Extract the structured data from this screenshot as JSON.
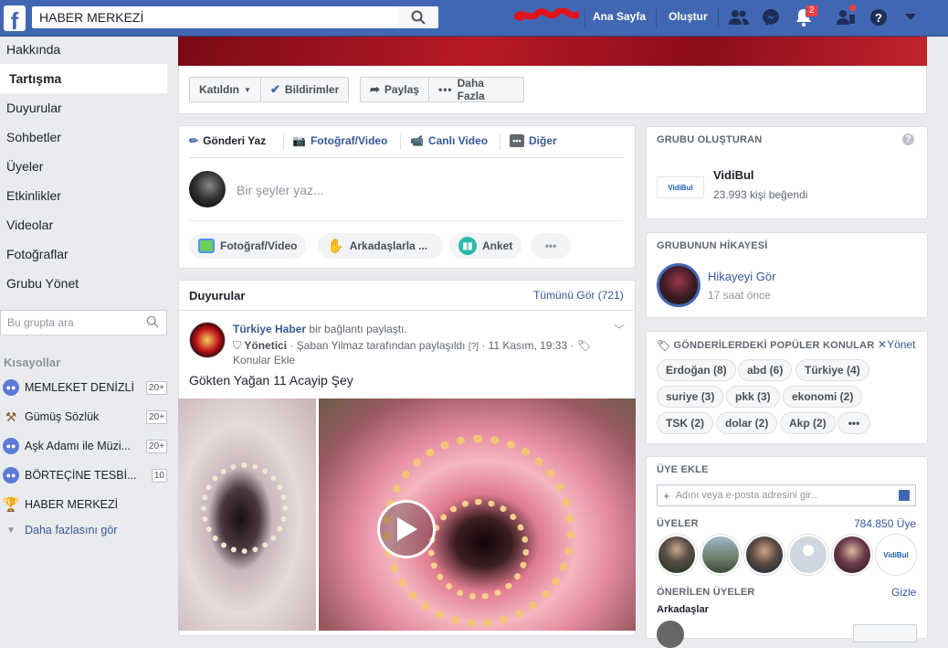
{
  "topbar": {
    "search_value": "HABER MERKEZİ",
    "home": "Ana Sayfa",
    "create": "Oluştur",
    "notif_count": "2"
  },
  "cover": {
    "joined": "Katıldın",
    "notifications": "Bildirimler",
    "share": "Paylaş",
    "more": "Daha Fazla"
  },
  "leftnav": {
    "items": [
      "Hakkında",
      "Tartışma",
      "Duyurular",
      "Sohbetler",
      "Üyeler",
      "Etkinlikler",
      "Videolar",
      "Fotoğraflar",
      "Grubu Yönet"
    ],
    "search_placeholder": "Bu grupta ara",
    "shortcuts_title": "Kısayollar",
    "shortcuts": [
      {
        "label": "MEMLEKET DENİZLİ",
        "count": "20+"
      },
      {
        "label": "Gümüş Sözlük",
        "count": "20+"
      },
      {
        "label": "Aşk Adamı ile Müzi...",
        "count": "20+"
      },
      {
        "label": "BÖRTEÇİNE TESBİ...",
        "count": "10"
      },
      {
        "label": "HABER MERKEZİ",
        "count": ""
      }
    ],
    "see_more": "Daha fazlasını gör"
  },
  "composer": {
    "tabs": [
      "Gönderi Yaz",
      "Fotoğraf/Video",
      "Canlı Video",
      "Diğer"
    ],
    "placeholder": "Bir şeyler yaz...",
    "actions": [
      "Fotoğraf/Video",
      "Arkadaşlarla ...",
      "Anket",
      "•••"
    ]
  },
  "announcements": {
    "title": "Duyurular",
    "see_all": "Tümünü Gör (721)"
  },
  "post": {
    "author": "Türkiye Haber",
    "action": "bir bağlantı paylaştı.",
    "role": "Yönetici",
    "shared_by": "Şaban Yilmaz tarafından paylaşıldı",
    "help": "[?]",
    "date": "11 Kasım, 19:33",
    "topics": "Konular Ekle",
    "text": "Gökten Yağan 11 Acayip Şey"
  },
  "creator": {
    "title": "GRUBU OLUŞTURAN",
    "name": "VidiBul",
    "likes": "23.993 kişi beğendi",
    "logo_text": "VidiBul"
  },
  "story": {
    "title": "GRUBUNUN HİKAYESİ",
    "see": "Hikayeyi Gör",
    "time": "17 saat önce"
  },
  "topics": {
    "title": "GÖNDERİLERDEKİ POPÜLER KONULAR",
    "manage": "Yönet",
    "tags": [
      "Erdoğan (8)",
      "abd (6)",
      "Türkiye (4)",
      "suriye (3)",
      "pkk (3)",
      "ekonomi (2)",
      "TSK (2)",
      "dolar (2)",
      "Akp (2)",
      "•••"
    ]
  },
  "members": {
    "add_title": "ÜYE EKLE",
    "add_placeholder": "Adını veya e-posta adresini gir...",
    "members_title": "ÜYELER",
    "members_count": "784.850 Üye",
    "suggested_title": "ÖNERİLEN ÜYELER",
    "hide": "Gizle",
    "friends": "Arkadaşlar"
  }
}
